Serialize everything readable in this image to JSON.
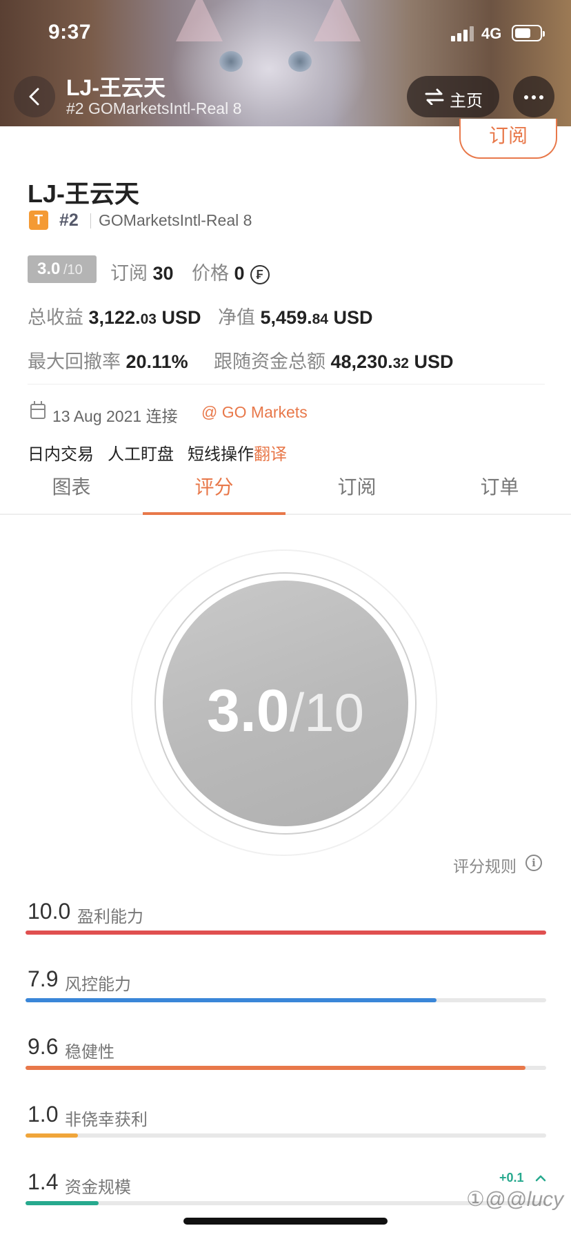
{
  "status_bar": {
    "time": "9:37",
    "network": "4G"
  },
  "header": {
    "title": "LJ-王云天",
    "subtitle": "#2 GOMarketsIntl-Real 8",
    "home_label": "主页"
  },
  "profile": {
    "subscribe_label": "订阅",
    "name": "LJ-王云天",
    "badge": "T",
    "rank": "#2",
    "broker": "GOMarketsIntl-Real 8",
    "score_main": "3.0",
    "score_of": "/10",
    "subs_label": "订阅",
    "subs_value": "30",
    "price_label": "价格",
    "price_value": "0",
    "coin_symbol": "₣",
    "profit_label": "总收益",
    "profit_int": "3,122.",
    "profit_dec": "03",
    "profit_unit": "USD",
    "nav_label": "净值",
    "nav_int": "5,459.",
    "nav_dec": "84",
    "nav_unit": "USD",
    "drawdown_label": "最大回撤率",
    "drawdown_value": "20.11%",
    "follow_label": "跟随资金总额",
    "follow_int": "48,230.",
    "follow_dec": "32",
    "follow_unit": "USD",
    "date": "13 Aug 2021 连接",
    "at_broker": "@ GO Markets",
    "tags": [
      "日内交易",
      "人工盯盘",
      "短线操作"
    ],
    "translate": "翻译"
  },
  "tabs": [
    "图表",
    "评分",
    "订阅",
    "订单"
  ],
  "active_tab": 1,
  "score_circle": {
    "score": "3.0",
    "of": "/10"
  },
  "rule_label": "评分规则",
  "metrics": [
    {
      "value": "10.0",
      "name": "盈利能力",
      "fraction": 1.0,
      "color": "#e05050"
    },
    {
      "value": "7.9",
      "name": "风控能力",
      "fraction": 0.79,
      "color": "#3a86d8"
    },
    {
      "value": "9.6",
      "name": "稳健性",
      "fraction": 0.96,
      "color": "#e8784a"
    },
    {
      "value": "1.0",
      "name": "非侥幸获利",
      "fraction": 0.1,
      "color": "#f0a53a"
    },
    {
      "value": "1.4",
      "name": "资金规模",
      "fraction": 0.14,
      "color": "#27a98e"
    }
  ],
  "metric_delta": "+0.1",
  "watermark": "①@@lucy",
  "colors": {
    "accent": "#e8784a",
    "green": "#27a98e"
  }
}
